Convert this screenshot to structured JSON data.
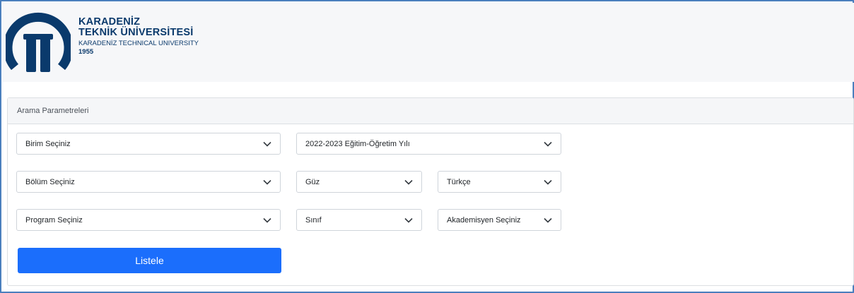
{
  "brand": {
    "line1": "KARADENİZ",
    "line2": "TEKNİK ÜNİVERSİTESİ",
    "line3": "KARADENİZ TECHNICAL UNIVERSITY",
    "year": "1955",
    "color": "#0a3a6c"
  },
  "panel": {
    "title": "Arama Parametreleri"
  },
  "filters": {
    "birim": "Birim Seçiniz",
    "yil": "2022-2023 Eğitim-Öğretim Yılı",
    "bolum": "Bölüm Seçiniz",
    "donem": "Güz",
    "dil": "Türkçe",
    "program": "Program Seçiniz",
    "sinif": "Sınıf",
    "akademisyen": "Akademisyen Seçiniz"
  },
  "actions": {
    "list_label": "Listele",
    "accent": "#1b6efc"
  },
  "icons": {
    "dropdown": "chevron-down-icon",
    "logo": "ktu-logo"
  }
}
